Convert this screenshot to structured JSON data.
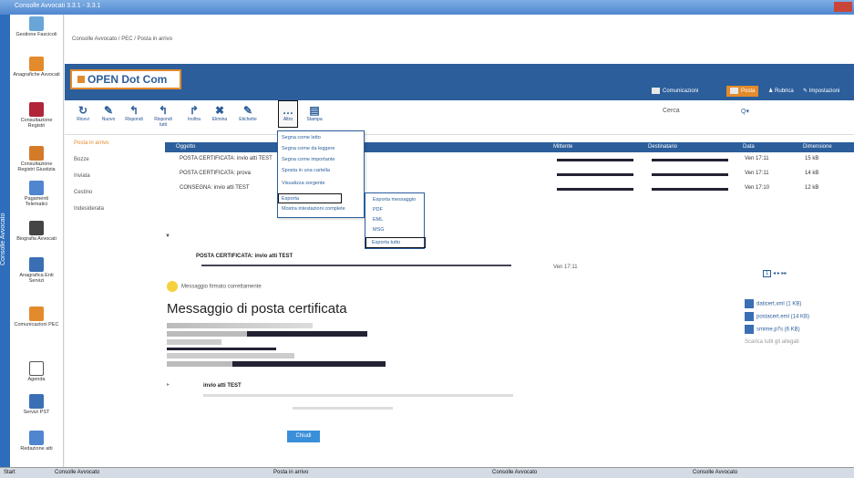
{
  "window": {
    "title": "Consolle Avvocati 3.3.1 - 3.3.1"
  },
  "sidebar": {
    "vertical_label": "Consolle Avvocato",
    "items": [
      {
        "label": "Gestione Fascicoli",
        "color": "#6aa5d8"
      },
      {
        "label": "Anagrafiche Avvocati",
        "color": "#e38b2c"
      },
      {
        "label": "Consultazione Registri",
        "color": "#b1243a"
      },
      {
        "label": "Consultazione Registri Giustizia",
        "color": "#d47b2a"
      },
      {
        "label": "Pagamenti Telematici",
        "color": "#4f86cf"
      },
      {
        "label": "Biografia Avvocati",
        "color": "#444444"
      },
      {
        "label": "Anagrafica Enti Servizi",
        "color": "#3a6fb4"
      },
      {
        "label": "Comunicazioni PEC",
        "color": "#e38b2c"
      },
      {
        "label": "Agenda",
        "color": "#555555"
      },
      {
        "label": "Servizi PST",
        "color": "#3a6fb4"
      },
      {
        "label": "Redazione atti",
        "color": "#4f86cf"
      }
    ]
  },
  "address": "Consolle Avvocato / PEC / Posta in arrivo",
  "brand": {
    "name": "OPEN Dot Com"
  },
  "topnav": [
    {
      "label": "Comunicazioni"
    },
    {
      "label": "Posta"
    },
    {
      "label": "Rubrica"
    },
    {
      "label": "Impostazioni"
    }
  ],
  "toolbar": [
    {
      "label": "Ricevi",
      "glyph": "↻"
    },
    {
      "label": "Nuovo",
      "glyph": "✎"
    },
    {
      "label": "Rispondi",
      "glyph": "↰"
    },
    {
      "label": "Rispondi tutti",
      "glyph": "↰"
    },
    {
      "label": "Inoltra",
      "glyph": "↱"
    },
    {
      "label": "Elimina",
      "glyph": "✖"
    },
    {
      "label": "Etichette",
      "glyph": "✎"
    },
    {
      "label": "Altro",
      "glyph": "…"
    },
    {
      "label": "Stampa",
      "glyph": "▤"
    }
  ],
  "search": {
    "label": "Cerca",
    "filter": "Q▾"
  },
  "folders": [
    "Posta in arrivo",
    "Bozze",
    "Inviata",
    "Cestino",
    "Indesiderata"
  ],
  "list_columns": {
    "subject": "Oggetto",
    "sender": "Mittente",
    "recipient": "Destinatario",
    "date": "Data",
    "size": "Dimensione"
  },
  "rows": [
    {
      "subject": "POSTA CERTIFICATA: invio atti TEST",
      "date": "Ven 17:11",
      "size": "15 kB"
    },
    {
      "subject": "POSTA CERTIFICATA: prova",
      "date": "Ven 17:11",
      "size": "14 kB"
    },
    {
      "subject": "CONSEGNA: invio atti TEST",
      "date": "Ven 17:10",
      "size": "12 kB"
    }
  ],
  "more_menu": [
    "Segna come letto",
    "Segna come da leggere",
    "Segna come importante",
    "Sposta in una cartella",
    "Visualizza sorgente",
    "Esporta",
    "Mostra intestazioni complete"
  ],
  "export_submenu": [
    "Esporta messaggio",
    "PDF",
    "EML",
    "MSG",
    "Esporta tutto"
  ],
  "preview": {
    "header": "POSTA CERTIFICATA: invio atti TEST",
    "date": "Ven 17:11",
    "banner": "Messaggio firmato correttamente",
    "title": "Messaggio di posta certificata",
    "attachments": [
      "daticert.xml (1 KB)",
      "postacert.eml (14 KB)",
      "smime.p7s (6 KB)"
    ],
    "attach_all": "Scarica tutti gli allegati",
    "section": "invio atti TEST",
    "ok_label": "Chiudi",
    "pager": "1"
  },
  "taskbar": [
    {
      "label": "Start"
    },
    {
      "label": "Consolle Avvocato"
    },
    {
      "label": "Posta in arrivo"
    },
    {
      "label": "Consolle Avvocato"
    },
    {
      "label": "Consolle Avvocato"
    }
  ]
}
